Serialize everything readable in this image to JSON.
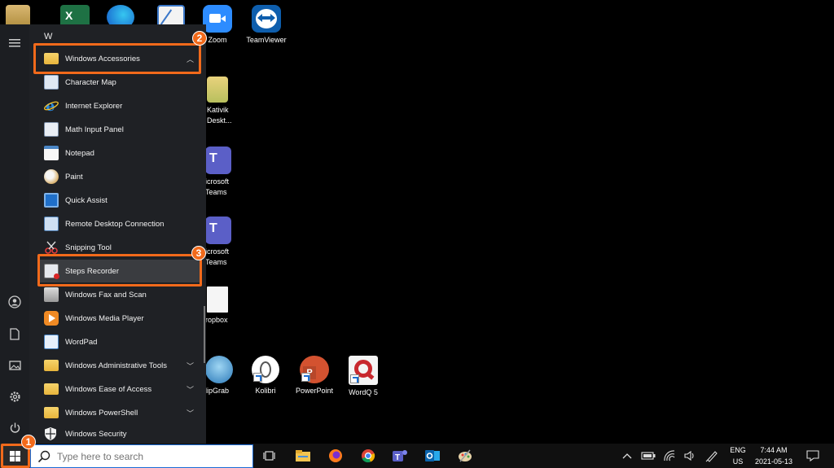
{
  "desktop": {
    "icons": [
      {
        "label": "Zoom"
      },
      {
        "label": "TeamViewer"
      },
      {
        "label": "Kativik Deskt..."
      },
      {
        "label": "icrosoft Teams"
      },
      {
        "label": "icrosoft Teams"
      },
      {
        "label": "ropbox"
      },
      {
        "label": "lipGrab"
      },
      {
        "label": "Kolibri"
      },
      {
        "label": "PowerPoint"
      },
      {
        "label": "WordQ 5"
      }
    ]
  },
  "start_menu": {
    "section_letter": "W",
    "items": [
      {
        "label": "Windows Accessories",
        "icon": "folder-icon",
        "expanded": true
      },
      {
        "label": "Character Map",
        "icon": "character-map-icon"
      },
      {
        "label": "Internet Explorer",
        "icon": "internet-explorer-icon"
      },
      {
        "label": "Math Input Panel",
        "icon": "math-input-panel-icon"
      },
      {
        "label": "Notepad",
        "icon": "notepad-icon"
      },
      {
        "label": "Paint",
        "icon": "paint-icon"
      },
      {
        "label": "Quick Assist",
        "icon": "quick-assist-icon"
      },
      {
        "label": "Remote Desktop Connection",
        "icon": "remote-desktop-icon"
      },
      {
        "label": "Snipping Tool",
        "icon": "snipping-tool-icon"
      },
      {
        "label": "Steps Recorder",
        "icon": "steps-recorder-icon"
      },
      {
        "label": "Windows Fax and Scan",
        "icon": "fax-scan-icon"
      },
      {
        "label": "Windows Media Player",
        "icon": "media-player-icon"
      },
      {
        "label": "WordPad",
        "icon": "wordpad-icon"
      },
      {
        "label": "Windows Administrative Tools",
        "icon": "folder-icon"
      },
      {
        "label": "Windows Ease of Access",
        "icon": "folder-icon"
      },
      {
        "label": "Windows PowerShell",
        "icon": "folder-icon"
      },
      {
        "label": "Windows Security",
        "icon": "shield-icon"
      }
    ],
    "callouts": [
      "1",
      "2",
      "3"
    ]
  },
  "taskbar": {
    "search_placeholder": "Type here to search",
    "language_top": "ENG",
    "language_bottom": "US",
    "time": "7:44 AM",
    "date": "2021-05-13"
  },
  "colors": {
    "highlight": "#f26a1b",
    "menu_bg": "#1f2125",
    "taskbar_bg": "#101010"
  }
}
